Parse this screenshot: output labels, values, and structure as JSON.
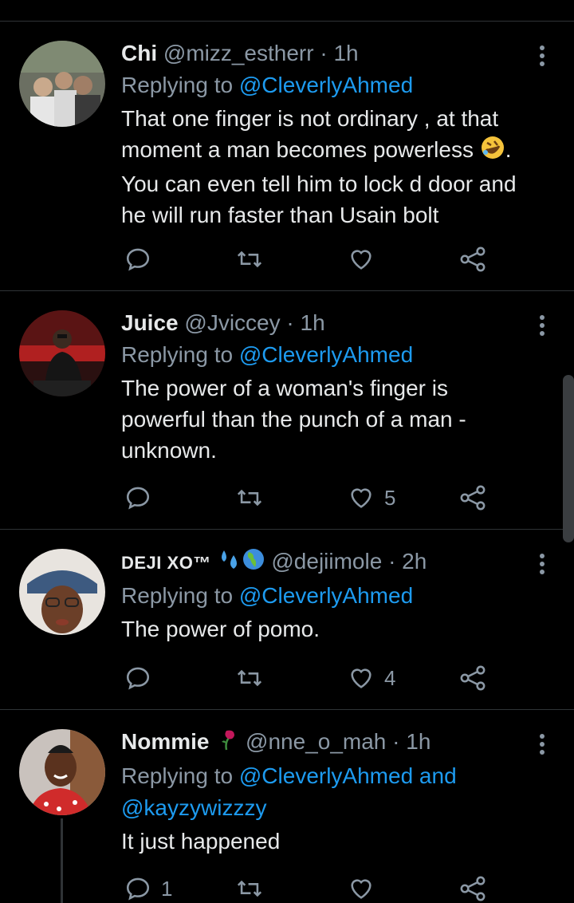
{
  "tweets": [
    {
      "name": "Chi",
      "handle": "@mizz_estherr",
      "time": "· 1h",
      "replying_prefix": "Replying to ",
      "replying_to": "@CleverlyAhmed",
      "body_lines": [
        "That one finger is not ordinary , at that",
        "moment a man becomes powerless",
        "You can even tell him to lock d door and",
        "he will run faster than Usain bolt"
      ],
      "body_suffix": ".",
      "emoji": "rolling-on-floor-laughing",
      "replies": "",
      "retweets": "",
      "likes": ""
    },
    {
      "name": "Juice",
      "handle": "@Jviccey",
      "time": "· 1h",
      "replying_prefix": "Replying to ",
      "replying_to": "@CleverlyAhmed",
      "body_lines": [
        "The power of a woman's finger is",
        "powerful than the punch of a man -",
        "unknown."
      ],
      "replies": "",
      "retweets": "",
      "likes": "5"
    },
    {
      "name": "DEJI XO™",
      "handle": "@dejiimole",
      "time": "· 2h",
      "replying_prefix": "Replying to ",
      "replying_to": "@CleverlyAhmed",
      "body_lines": [
        "The power of pomo."
      ],
      "name_emojis": [
        "sweat-droplets",
        "globe-africa"
      ],
      "replies": "",
      "retweets": "",
      "likes": "4"
    },
    {
      "name": "Nommie",
      "handle": "@nne_o_mah",
      "time": "· 1h",
      "replying_prefix": "Replying to ",
      "replying_to": "@CleverlyAhmed and",
      "replying_to_2": "@kayzywizzzy",
      "body_lines": [
        "It just happened"
      ],
      "name_emojis": [
        "wilted-flower"
      ],
      "replies": "1",
      "retweets": "",
      "likes": ""
    }
  ],
  "colors": {
    "background": "#000000",
    "text": "#e7e9ea",
    "muted": "#8b98a5",
    "accent": "#1d9bf0",
    "divider": "#2f3336"
  },
  "icons": [
    "reply-icon",
    "retweet-icon",
    "like-icon",
    "share-icon",
    "more-icon"
  ]
}
